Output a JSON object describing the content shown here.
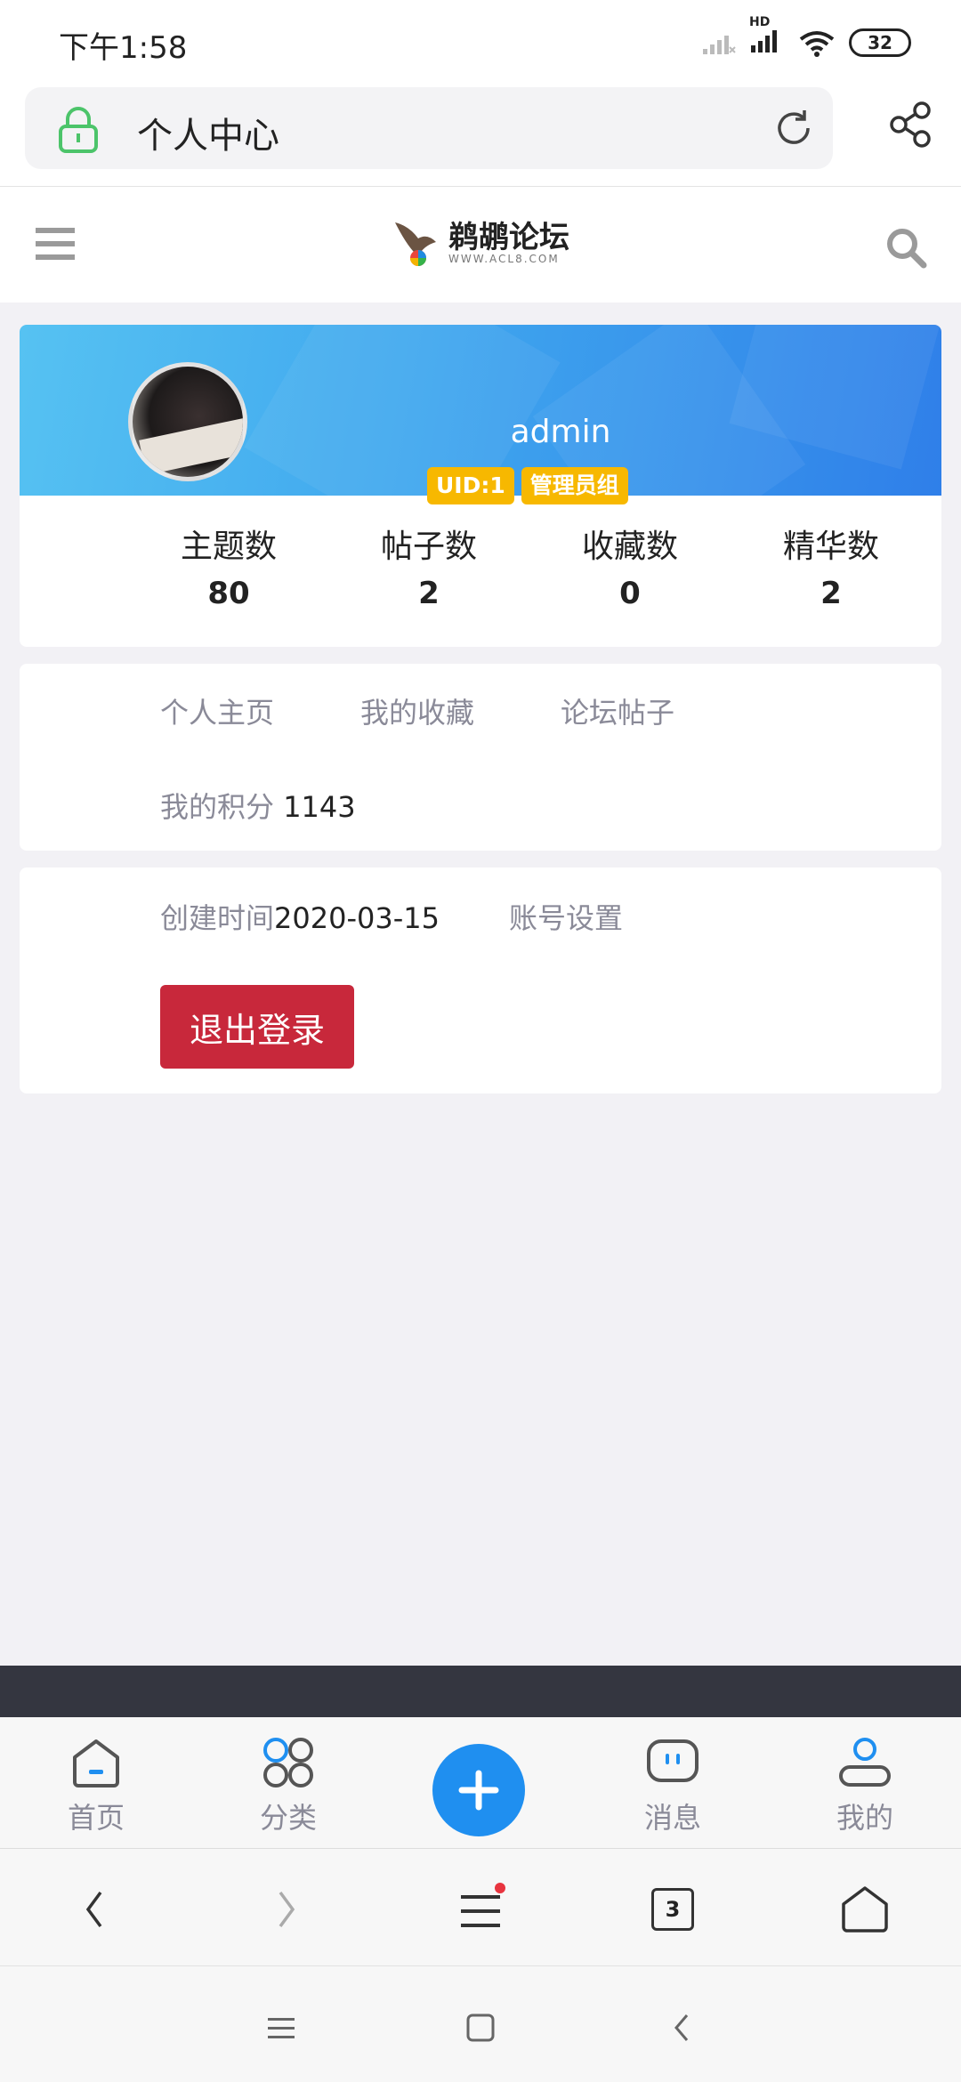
{
  "status_bar": {
    "time": "下午1:58",
    "network": "HD",
    "battery": "32"
  },
  "browser": {
    "page_title": "个人中心",
    "tab_count": "3"
  },
  "site": {
    "name": "鹈鹕论坛",
    "domain": "WWW.ACL8.COM"
  },
  "profile": {
    "username": "admin",
    "badges": [
      "UID:1",
      "管理员组"
    ],
    "stats": [
      {
        "label": "主题数",
        "value": "80"
      },
      {
        "label": "帖子数",
        "value": "2"
      },
      {
        "label": "收藏数",
        "value": "0"
      },
      {
        "label": "精华数",
        "value": "2"
      }
    ]
  },
  "links": {
    "homepage": "个人主页",
    "favorites": "我的收藏",
    "posts": "论坛帖子",
    "points_label": "我的积分",
    "points_value": "1143"
  },
  "account": {
    "created_label": "创建时间",
    "created_date": "2020-03-15",
    "settings": "账号设置",
    "logout": "退出登录"
  },
  "tabbar": {
    "items": [
      {
        "label": "首页"
      },
      {
        "label": "分类"
      },
      {
        "label": "消息"
      },
      {
        "label": "我的"
      }
    ]
  },
  "colors": {
    "accent": "#1f8ff0",
    "badge": "#f7b800",
    "logout": "#c8283b",
    "banner_start": "#56c2f2",
    "banner_end": "#2f7fe9"
  }
}
